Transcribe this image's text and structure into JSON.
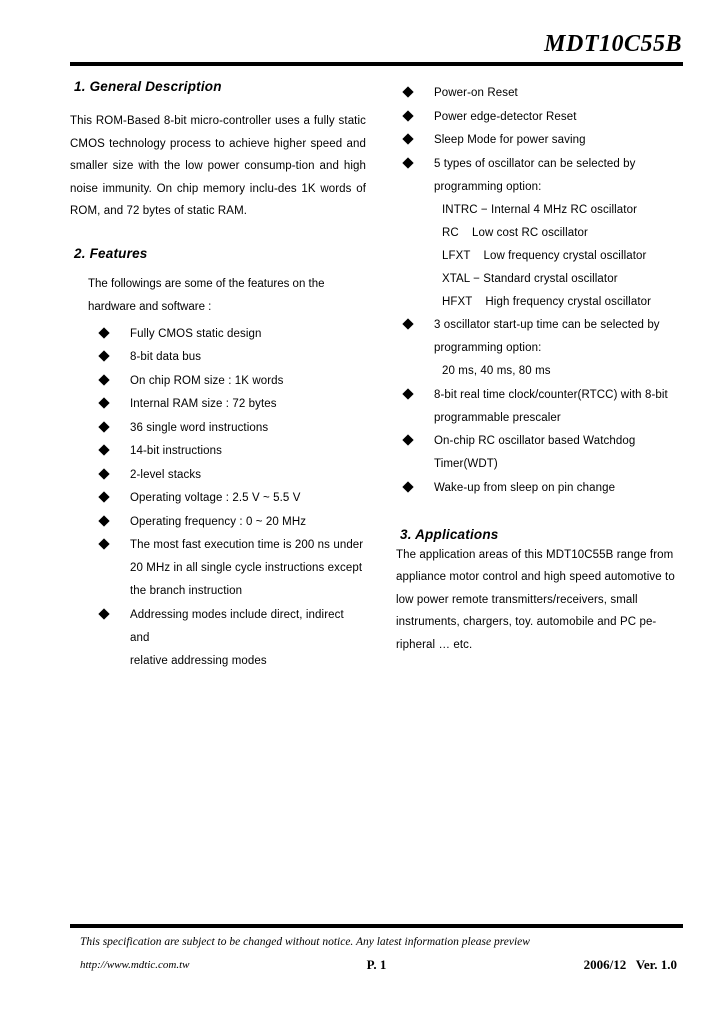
{
  "header": {
    "doc_title": "MDT10C55B"
  },
  "left_column": {
    "general_description": {
      "heading": "1. General Description",
      "paragraph": "This ROM-Based 8-bit micro-controller uses a fully static CMOS technology process to achieve higher speed and smaller size with the low power consump-tion and high noise immunity. On chip memory inclu-des 1K words of ROM, and 72 bytes of static RAM."
    },
    "features": {
      "heading": "2. Features",
      "intro": [
        "The followings are some of the features on the",
        "hardware and software :"
      ],
      "items": [
        {
          "text": "Fully CMOS static design"
        },
        {
          "text": "8-bit data bus"
        },
        {
          "text": "On chip ROM size : 1K words"
        },
        {
          "text": "Internal RAM size : 72 bytes"
        },
        {
          "text": "36 single word instructions"
        },
        {
          "text": "14-bit instructions"
        },
        {
          "text": "2-level stacks"
        },
        {
          "text": "Operating voltage : 2.5 V ~ 5.5 V"
        },
        {
          "text": "Operating frequency : 0 ~ 20 MHz"
        },
        {
          "text": "The most fast execution time is 200 ns under",
          "cont": [
            "20 MHz in all single cycle instructions except",
            "the branch instruction"
          ]
        },
        {
          "text": "Addressing modes include direct, indirect and",
          "cont": [
            "relative addressing modes"
          ]
        }
      ]
    }
  },
  "right_column": {
    "items": [
      {
        "text": "Power-on Reset"
      },
      {
        "text": "Power edge-detector Reset"
      },
      {
        "text": "Sleep Mode for power saving"
      },
      {
        "text": " 5 types of oscillator can be selected by",
        "cont": [
          " programming option:"
        ],
        "sub": [
          "INTRC − Internal 4 MHz RC oscillator",
          "RC    Low cost RC oscillator",
          "LFXT    Low frequency crystal oscillator",
          "XTAL − Standard crystal oscillator",
          "HFXT    High frequency crystal oscillator"
        ]
      },
      {
        "text": " 3 oscillator start-up time can be selected by",
        "cont": [
          " programming option:"
        ],
        "sub": [
          "20 ms, 40 ms, 80 ms"
        ]
      },
      {
        "text": "8-bit real time clock/counter(RTCC) with 8-bit",
        "cont": [
          "programmable prescaler"
        ]
      },
      {
        "text": "On-chip RC oscillator based Watchdog",
        "cont": [
          "Timer(WDT)"
        ]
      },
      {
        "text": "Wake-up from sleep on pin change"
      }
    ],
    "applications": {
      "heading": "3. Applications",
      "paragraph": "The application areas of this MDT10C55B range from appliance motor control and high speed automotive to low power remote transmitters/receivers, small instruments, chargers, toy. automobile and PC pe-ripheral … etc."
    }
  },
  "footer": {
    "note": "This specification are subject to be changed without notice. Any latest information please preview",
    "url": "http://www.mdtic.com.tw",
    "page": "P. 1",
    "version": "2006/12   Ver. 1.0"
  }
}
